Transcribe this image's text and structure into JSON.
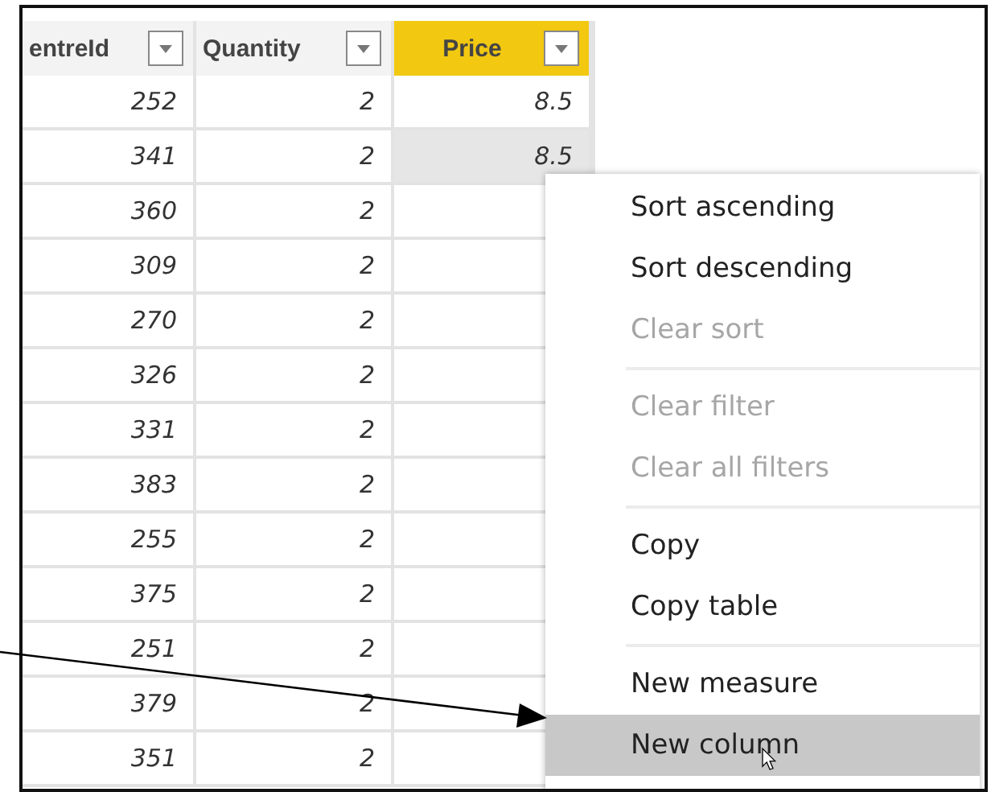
{
  "table": {
    "columns": [
      {
        "label": "entreId",
        "selected": false
      },
      {
        "label": "Quantity",
        "selected": false
      },
      {
        "label": "Price",
        "selected": true
      }
    ],
    "rows": [
      {
        "cells": [
          "252",
          "2",
          "8.5"
        ],
        "selected": false
      },
      {
        "cells": [
          "341",
          "2",
          "8.5"
        ],
        "selected": true
      },
      {
        "cells": [
          "360",
          "2"
        ],
        "selected": false
      },
      {
        "cells": [
          "309",
          "2"
        ],
        "selected": false
      },
      {
        "cells": [
          "270",
          "2"
        ],
        "selected": false
      },
      {
        "cells": [
          "326",
          "2"
        ],
        "selected": false
      },
      {
        "cells": [
          "331",
          "2"
        ],
        "selected": false
      },
      {
        "cells": [
          "383",
          "2"
        ],
        "selected": false
      },
      {
        "cells": [
          "255",
          "2"
        ],
        "selected": false
      },
      {
        "cells": [
          "375",
          "2"
        ],
        "selected": false
      },
      {
        "cells": [
          "251",
          "2"
        ],
        "selected": false
      },
      {
        "cells": [
          "379",
          "2"
        ],
        "selected": false
      },
      {
        "cells": [
          "351",
          "2"
        ],
        "selected": false
      }
    ]
  },
  "context_menu": {
    "groups": [
      [
        {
          "label": "Sort ascending",
          "disabled": false,
          "selected": false
        },
        {
          "label": "Sort descending",
          "disabled": false,
          "selected": false
        },
        {
          "label": "Clear sort",
          "disabled": true,
          "selected": false
        }
      ],
      [
        {
          "label": "Clear filter",
          "disabled": true,
          "selected": false
        },
        {
          "label": "Clear all filters",
          "disabled": true,
          "selected": false
        }
      ],
      [
        {
          "label": "Copy",
          "disabled": false,
          "selected": false
        },
        {
          "label": "Copy table",
          "disabled": false,
          "selected": false
        }
      ],
      [
        {
          "label": "New measure",
          "disabled": false,
          "selected": false
        },
        {
          "label": "New column",
          "disabled": false,
          "selected": true
        }
      ]
    ]
  }
}
